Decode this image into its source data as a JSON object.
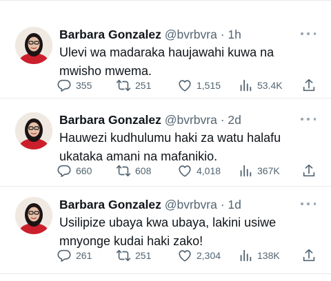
{
  "colors": {
    "text": "#0f1419",
    "secondary": "#536471",
    "divider": "#e7e9ea",
    "avatar_top": "#cc1f2c"
  },
  "icons": {
    "reply": "reply-icon",
    "retweet": "retweet-icon",
    "like": "heart-icon",
    "views": "views-icon",
    "share": "share-icon",
    "more": "more-icon"
  },
  "tweets": [
    {
      "name": "Barbara Gonzalez",
      "handle": "@bvrbvra",
      "separator": "·",
      "time": "1h",
      "text": "Ulevi wa madaraka haujawahi kuwa na mwisho mwema.",
      "replies": "355",
      "retweets": "251",
      "likes": "1,515",
      "views": "53.4K"
    },
    {
      "name": "Barbara Gonzalez",
      "handle": "@bvrbvra",
      "separator": "·",
      "time": "2d",
      "text": "Hauwezi kudhulumu haki za watu halafu ukataka amani na mafanikio.",
      "replies": "660",
      "retweets": "608",
      "likes": "4,018",
      "views": "367K"
    },
    {
      "name": "Barbara Gonzalez",
      "handle": "@bvrbvra",
      "separator": "·",
      "time": "1d",
      "text": "Usilipize ubaya kwa ubaya, lakini usiwe mnyonge kudai haki zako!",
      "replies": "261",
      "retweets": "251",
      "likes": "2,304",
      "views": "138K"
    }
  ]
}
